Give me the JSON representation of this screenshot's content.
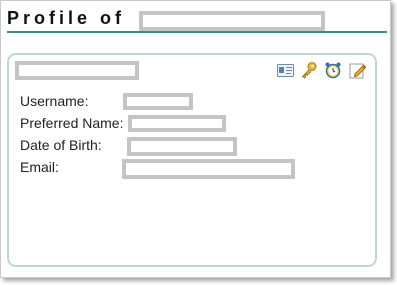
{
  "header": {
    "title": "Profile of",
    "name_redacted": true
  },
  "panel": {
    "name_redacted": true,
    "toolbar": [
      {
        "icon": "contact-card-icon"
      },
      {
        "icon": "key-icon"
      },
      {
        "icon": "alarm-clock-icon"
      },
      {
        "icon": "edit-pencil-icon"
      }
    ],
    "fields": {
      "username_label": "Username:",
      "preferred_name_label": "Preferred Name:",
      "dob_label": "Date of Birth:",
      "email_label": "Email:"
    }
  },
  "colors": {
    "header_rule": "#3b8f8a",
    "panel_border": "#bcd6db",
    "redaction": "#c4c4c4"
  }
}
